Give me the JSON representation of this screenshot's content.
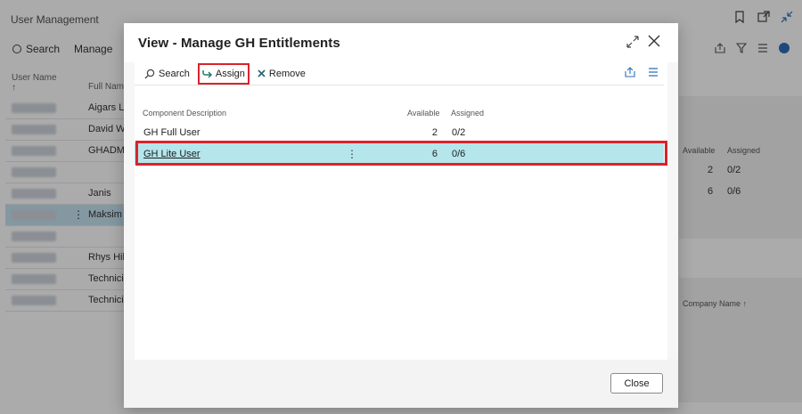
{
  "background": {
    "title": "User Management",
    "toolbar": {
      "search": "Search",
      "manage": "Manage"
    },
    "columns": {
      "user_name": "User Name",
      "sort_arrow": "↑",
      "full_name": "Full Name"
    },
    "rows": [
      "Aigars La",
      "David Wa",
      "GHADMI",
      "",
      "Janis",
      "Maksim",
      "",
      "Rhys Hill",
      "Technicia",
      "Technicia"
    ],
    "right_panel": {
      "available_header": "Available",
      "assigned_header": "Assigned",
      "rows": [
        {
          "available": "2",
          "assigned": "0/2"
        },
        {
          "available": "6",
          "assigned": "0/6"
        }
      ],
      "company_header": "Company Name ↑"
    }
  },
  "dialog": {
    "title": "View - Manage GH Entitlements",
    "actions": {
      "search": "Search",
      "assign": "Assign",
      "remove": "Remove"
    },
    "columns": {
      "description": "Component Description",
      "available": "Available",
      "assigned": "Assigned"
    },
    "rows": [
      {
        "description": "GH Full User",
        "available": "2",
        "assigned": "0/2"
      },
      {
        "description": "GH Lite User",
        "available": "6",
        "assigned": "0/6"
      }
    ],
    "close_label": "Close"
  },
  "colors": {
    "highlight": "#d9232a",
    "selected_row": "#b4e6ec",
    "accent": "#2a6fb8"
  }
}
